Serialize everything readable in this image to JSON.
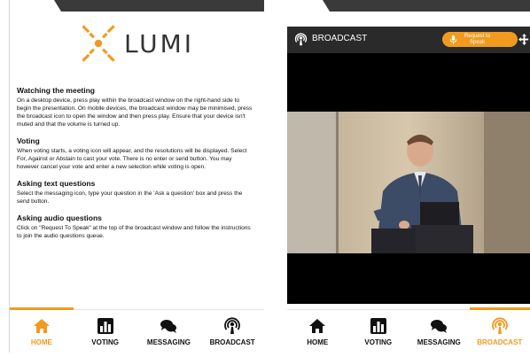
{
  "left_panel": {
    "logo_text": "LUMI",
    "sections": [
      {
        "heading": "Watching the meeting",
        "text": "On a desktop device, press play within the broadcast window on the right-hand side to begin the presentation. On mobile devices, the broadcast window may be minimised, press the broadcast icon to open the window and then press play. Ensure that your device isn't muted and that the volume is turned up."
      },
      {
        "heading": "Voting",
        "text": "When voting starts, a voting icon will appear, and the resolutions will be displayed. Select For, Against or Abstain to cast your vote. There is no enter or send button. You may however cancel your vote and enter a new selection while voting is open."
      },
      {
        "heading": "Asking text questions",
        "text": "Select the messaging icon, type your question in the 'Ask a question' box and press the send button."
      },
      {
        "heading": "Asking audio questions",
        "text": "Click on \"Request To Speak\" at the top of the broadcast window and follow the instructions to join the audio questions queue."
      }
    ],
    "nav": {
      "home": "HOME",
      "voting": "VOTING",
      "messaging": "MESSAGING",
      "broadcast": "BROADCAST"
    }
  },
  "right_panel": {
    "header_title": "BROADCAST",
    "request_line1": "Request to",
    "request_line2": "Speak",
    "nav": {
      "home": "HOME",
      "voting": "VOTING",
      "messaging": "MESSAGING",
      "broadcast": "BROADCAST"
    }
  },
  "colors": {
    "accent": "#f29a1e",
    "dark_header": "#2a2a2a",
    "video_bg": "#000000"
  },
  "icons": [
    "lumi-logo-icon",
    "home-icon",
    "voting-icon",
    "messaging-icon",
    "broadcast-icon",
    "microphone-icon",
    "move-icon"
  ],
  "left_active_tab": "home",
  "right_active_tab": "broadcast"
}
